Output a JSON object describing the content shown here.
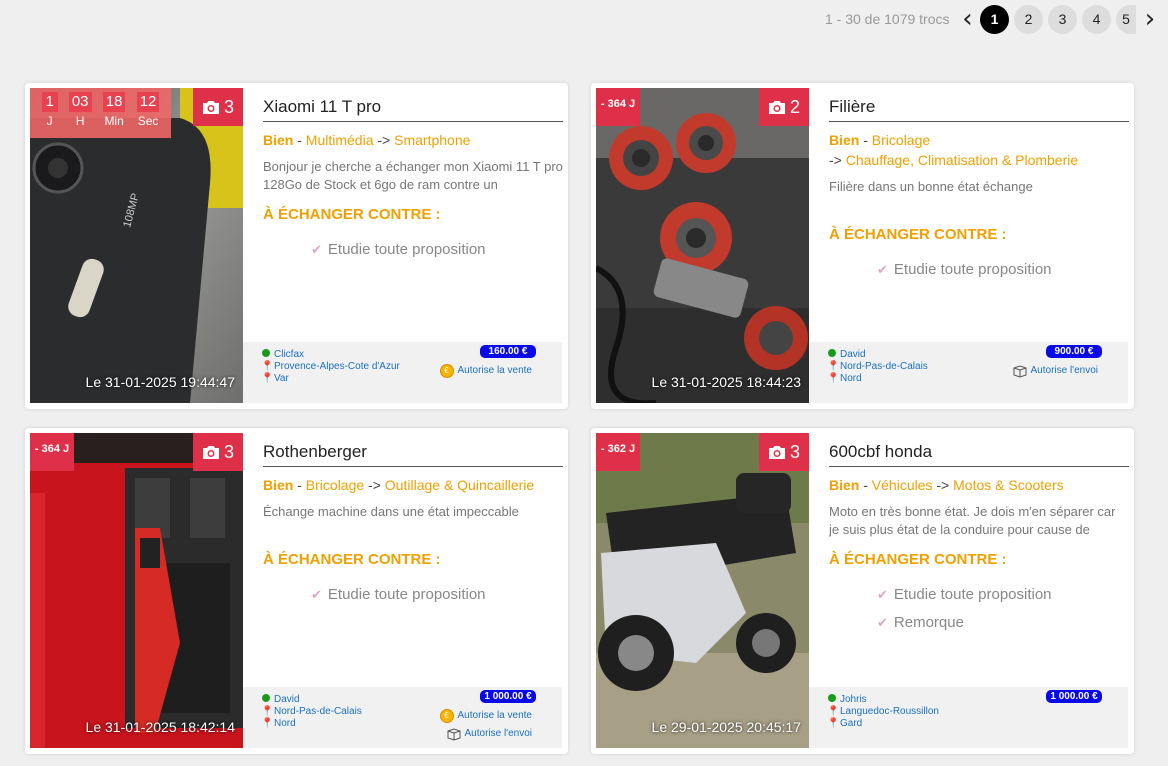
{
  "pagination": {
    "summary": "1 - 30 de 1079 trocs",
    "pages": [
      "1",
      "2",
      "3",
      "4",
      "5"
    ],
    "active": "1"
  },
  "exchange_title": "À ÉCHANGER CONTRE :",
  "cards": [
    {
      "title": "Xiaomi 11 T pro",
      "condition": "Bien",
      "category": "Multimédia",
      "subcategory": "Smartphone",
      "description": "Bonjour je cherche a échanger mon Xiaomi 11 T pro 128Go de Stock et 6go de ram contre un",
      "wishes": [
        "Etudie toute proposition"
      ],
      "photo_count": "3",
      "date": "Le 31-01-2025 19:44:47",
      "countdown": [
        {
          "value": "1",
          "label": "J"
        },
        {
          "value": "03",
          "label": "H"
        },
        {
          "value": "18",
          "label": "Min"
        },
        {
          "value": "12",
          "label": "Sec"
        }
      ],
      "user": "Clicfax",
      "region": "Provence-Alpes-Cote d'Azur",
      "department": "Var",
      "price": "160.00 €",
      "options": [
        "Autorise la vente"
      ]
    },
    {
      "title": "Filière",
      "condition": "Bien",
      "category": "Bricolage",
      "subcategory": "Chauffage, Climatisation & Plomberie",
      "description": "Filière dans un bonne état échange",
      "wishes": [
        "Etudie toute proposition"
      ],
      "photo_count": "2",
      "days": "- 364 J",
      "date": "Le 31-01-2025 18:44:23",
      "user": "David",
      "region": "Nord-Pas-de-Calais",
      "department": "Nord",
      "price": "900.00 €",
      "options": [
        "Autorise l'envoi"
      ]
    },
    {
      "title": "Rothenberger",
      "condition": "Bien",
      "category": "Bricolage",
      "subcategory": "Outillage & Quincaillerie",
      "description": "Échange machine dans une état impeccable",
      "wishes": [
        "Etudie toute proposition"
      ],
      "photo_count": "3",
      "days": "- 364 J",
      "date": "Le 31-01-2025 18:42:14",
      "user": "David",
      "region": "Nord-Pas-de-Calais",
      "department": "Nord",
      "price": "1 000.00 €",
      "options": [
        "Autorise la vente",
        "Autorise l'envoi"
      ]
    },
    {
      "title": "600cbf honda",
      "condition": "Bien",
      "category": "Véhicules",
      "subcategory": "Motos & Scooters",
      "description": "Moto en très bonne état. Je dois m'en séparer car je suis plus état de la conduire pour cause de",
      "wishes": [
        "Etudie toute proposition",
        "Remorque"
      ],
      "photo_count": "3",
      "days": "- 362 J",
      "date": "Le 29-01-2025 20:45:17",
      "user": "Johris",
      "region": "Languedoc-Roussillon",
      "department": "Gard",
      "price": "1 000.00 €",
      "options": []
    }
  ]
}
